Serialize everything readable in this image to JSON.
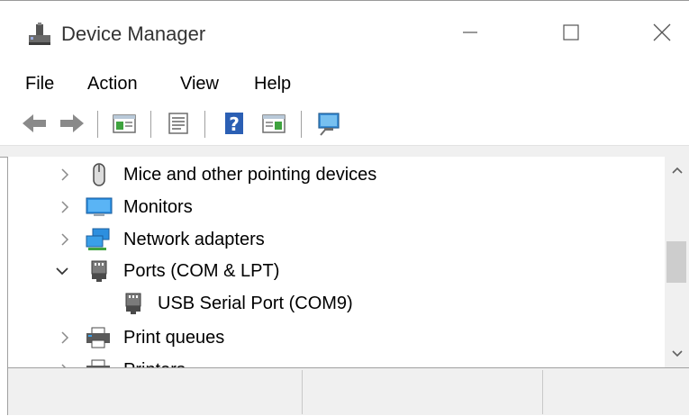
{
  "window": {
    "title": "Device Manager",
    "accent": "#0078d7"
  },
  "menu": {
    "file": "File",
    "action": "Action",
    "view": "View",
    "help": "Help"
  },
  "toolbar": {
    "buttons": [
      "back-arrow-icon",
      "forward-arrow-icon",
      "show-hide-console-tree-icon",
      "properties-icon",
      "help-icon",
      "action-pane-icon",
      "scan-hardware-changes-icon"
    ]
  },
  "tree": {
    "items": [
      {
        "label": "Mice and other pointing devices",
        "expanded": false,
        "icon": "mouse-icon"
      },
      {
        "label": "Monitors",
        "expanded": false,
        "icon": "monitor-icon"
      },
      {
        "label": "Network adapters",
        "expanded": false,
        "icon": "network-adapter-icon"
      },
      {
        "label": "Ports (COM & LPT)",
        "expanded": true,
        "icon": "port-icon"
      },
      {
        "label": "USB Serial Port (COM9)",
        "child": true,
        "icon": "port-icon"
      },
      {
        "label": "Print queues",
        "expanded": false,
        "icon": "printer-icon"
      },
      {
        "label": "Printers",
        "expanded": false,
        "icon": "printer-icon"
      }
    ]
  },
  "statusbar": {
    "panes": [
      "",
      "",
      ""
    ]
  }
}
